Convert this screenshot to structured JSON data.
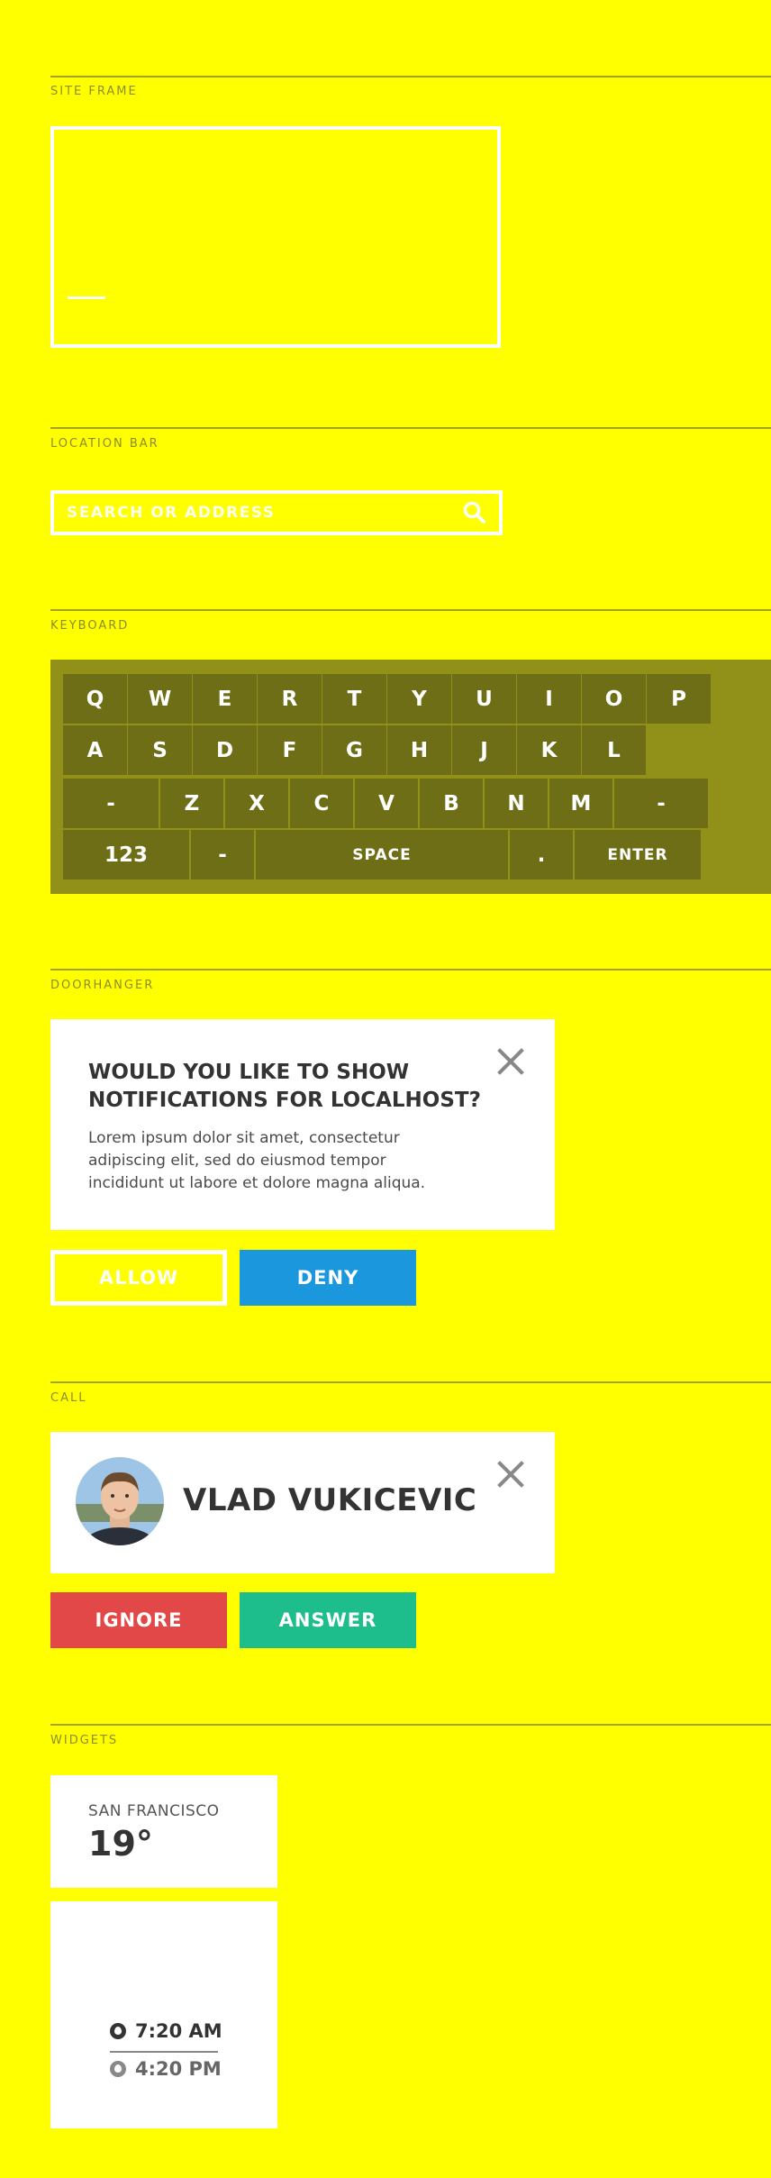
{
  "sections": {
    "site_frame": "SITE FRAME",
    "location_bar": "LOCATION BAR",
    "keyboard": "KEYBOARD",
    "doorhanger": "DOORHANGER",
    "call": "CALL",
    "widgets": "WIDGETS"
  },
  "location_bar": {
    "placeholder": "SEARCH OR ADDRESS"
  },
  "keyboard": {
    "rows": [
      [
        "Q",
        "W",
        "E",
        "R",
        "T",
        "Y",
        "U",
        "I",
        "O",
        "P"
      ],
      [
        "A",
        "S",
        "D",
        "F",
        "G",
        "H",
        "J",
        "K",
        "L"
      ],
      [
        "-",
        "Z",
        "X",
        "C",
        "V",
        "B",
        "N",
        "M",
        "-"
      ],
      [
        "123",
        "-",
        "SPACE",
        ".",
        "ENTER"
      ]
    ]
  },
  "doorhanger": {
    "title": "WOULD YOU LIKE TO SHOW NOTIFICATIONS FOR LOCALHOST?",
    "body": "Lorem ipsum dolor sit amet, consectetur adipiscing elit, sed do eiusmod tempor incididunt ut labore et dolore magna aliqua.",
    "allow": "ALLOW",
    "deny": "DENY"
  },
  "call": {
    "name": "VLAD VUKICEVIC",
    "ignore": "IGNORE",
    "answer": "ANSWER"
  },
  "widgets": {
    "weather": {
      "city": "SAN FRANCISCO",
      "temp": "19°"
    },
    "sun": {
      "sunrise": "7:20 AM",
      "sunset": "4:20 PM"
    }
  },
  "colors": {
    "background": "#ffff00",
    "keyboard_bg": "#919119",
    "key_bg": "#6e6e17",
    "deny": "#1a97dd",
    "ignore": "#e34848",
    "answer": "#1dbd8c"
  }
}
